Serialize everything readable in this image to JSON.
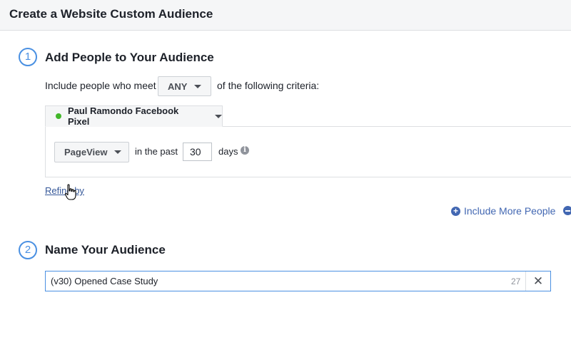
{
  "header": {
    "title": "Create a Website Custom Audience"
  },
  "step1": {
    "number": "1",
    "title": "Add People to Your Audience",
    "include_prefix": "Include people who meet",
    "match_selector": "ANY",
    "include_suffix": "of the following criteria:",
    "pixel": {
      "name": "Paul Ramondo Facebook Pixel",
      "status_color": "#42b72a"
    },
    "rule": {
      "event": "PageView",
      "in_the_past_label": "in the past",
      "days_value": "30",
      "days_label": "days",
      "info_icon": "i"
    },
    "refine_link": "Refine by",
    "include_more": {
      "icon": "+",
      "label": "Include More People"
    }
  },
  "step2": {
    "number": "2",
    "title": "Name Your Audience",
    "name_value": "(v30) Opened Case Study",
    "char_count": "27",
    "clear_icon": "✕"
  },
  "colors": {
    "accent": "#4a90e2",
    "link": "#4267b2",
    "header_bg": "#f5f6f7"
  }
}
